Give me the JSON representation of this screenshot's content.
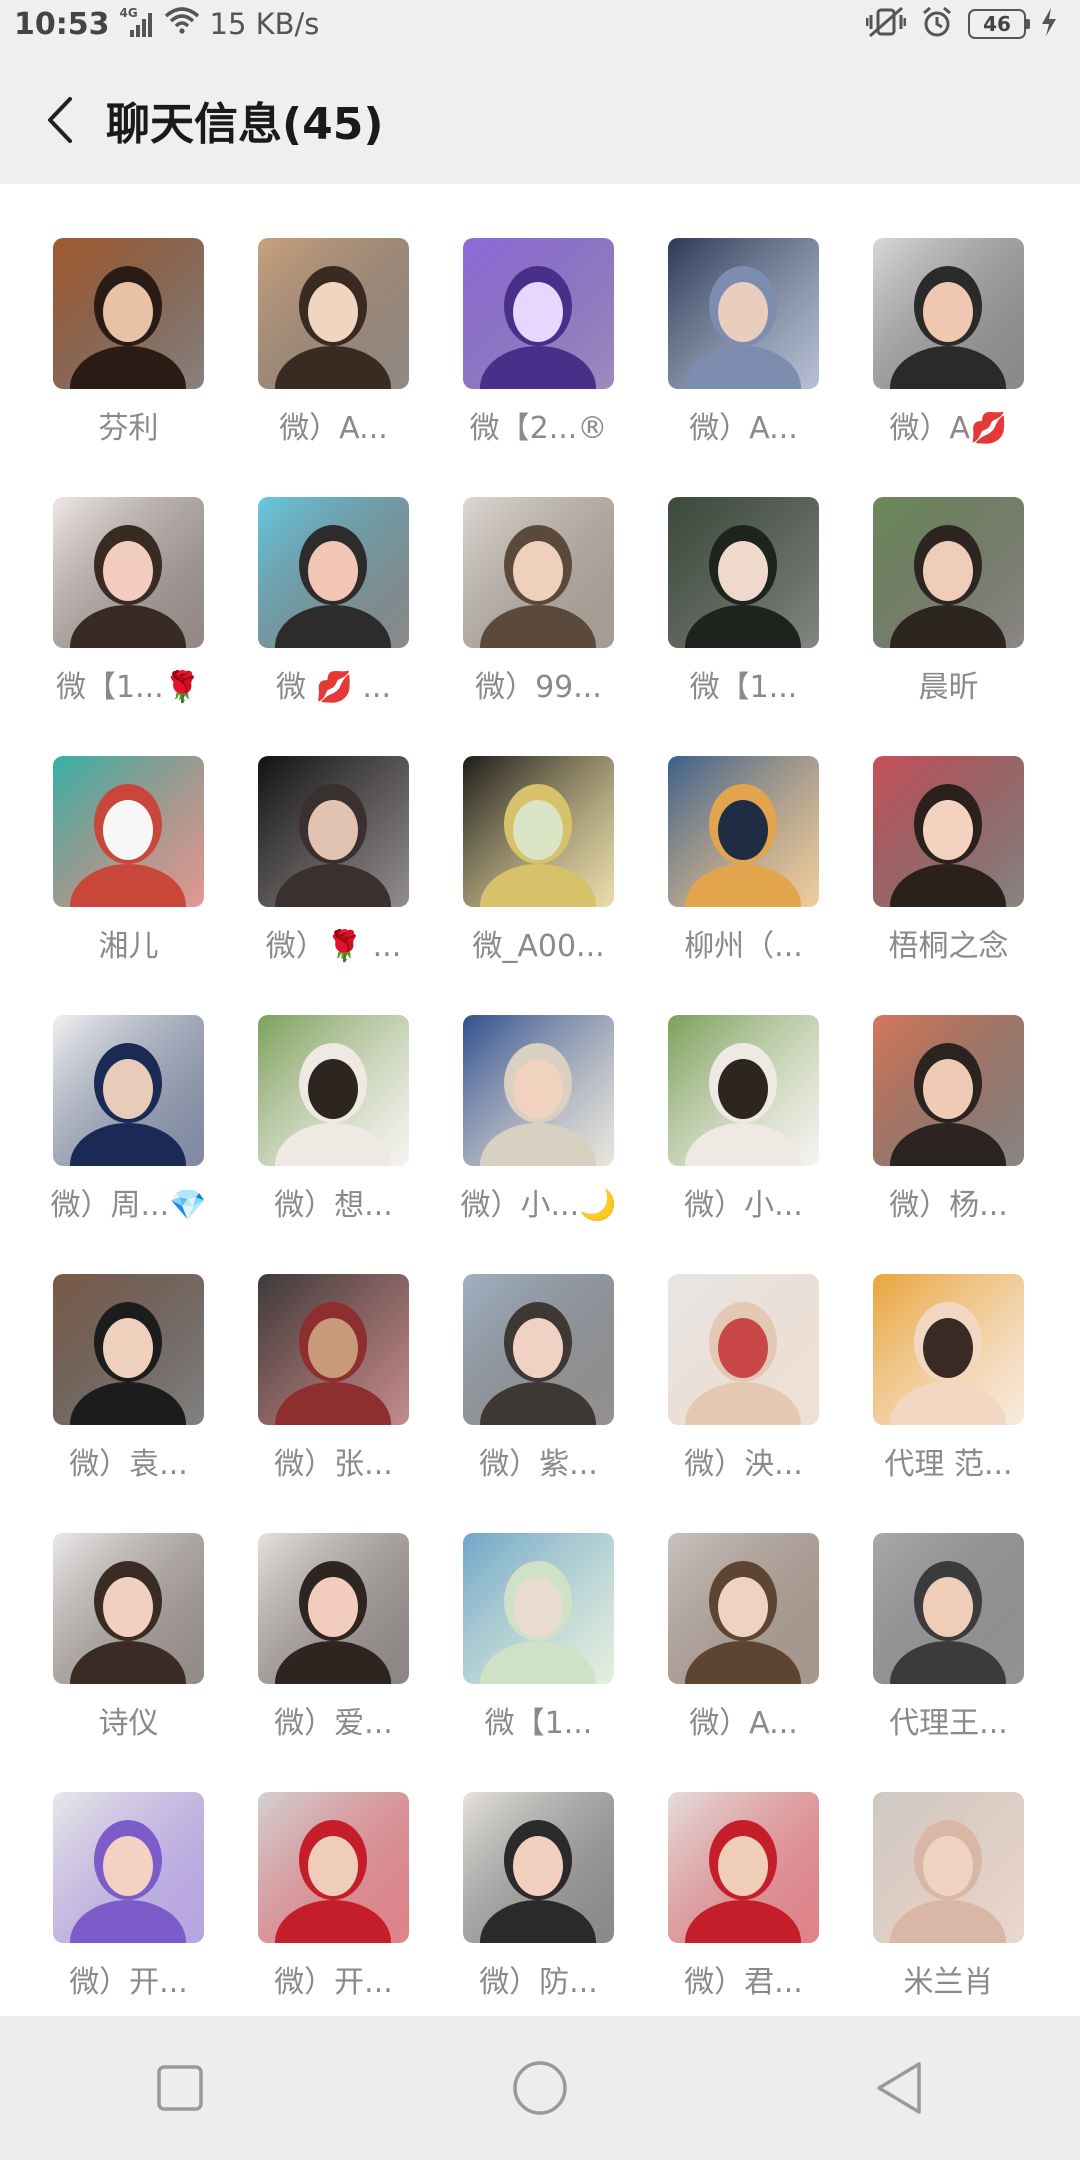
{
  "status_bar": {
    "time": "10:53",
    "network_label": "4G",
    "speed": "15 KB/s",
    "battery_level": "46"
  },
  "header": {
    "title": "聊天信息(45)"
  },
  "members": [
    {
      "name": "芬利",
      "colors": [
        "#a35a2e",
        "#2a1c15",
        "#e8c2a6"
      ]
    },
    {
      "name": "微）A...",
      "colors": [
        "#c9a27f",
        "#3a2b22",
        "#f0d6c0"
      ]
    },
    {
      "name": "微【2...®",
      "colors": [
        "#8e6bd8",
        "#4a2f8a",
        "#e7d7ff"
      ]
    },
    {
      "name": "微）A...",
      "colors": [
        "#2e3a54",
        "#7d8db0",
        "#e9cdbd"
      ]
    },
    {
      "name": "微）A💋",
      "colors": [
        "#d9d9d9",
        "#2a2a2a",
        "#f0c7b0"
      ]
    },
    {
      "name": "微【1...🌹",
      "colors": [
        "#efe8e6",
        "#3a2a24",
        "#f2cdbd"
      ]
    },
    {
      "name": "微 💋 ...",
      "colors": [
        "#68c8df",
        "#2d2b2b",
        "#f1c6b6"
      ]
    },
    {
      "name": "微）99...",
      "colors": [
        "#dcd8d2",
        "#5b4a3c",
        "#efd0bd"
      ]
    },
    {
      "name": "微【1...",
      "colors": [
        "#3b4a3a",
        "#1e241d",
        "#efd9cd"
      ]
    },
    {
      "name": "晨昕",
      "colors": [
        "#6a8a5a",
        "#2d2520",
        "#f0cdb8"
      ]
    },
    {
      "name": "湘儿",
      "colors": [
        "#34b3a8",
        "#c8473a",
        "#f7f7f7"
      ]
    },
    {
      "name": "微）🌹 ...",
      "colors": [
        "#121212",
        "#3a3030",
        "#e2c2b0"
      ]
    },
    {
      "name": "微_A00...",
      "colors": [
        "#1b1b1b",
        "#d7c16a",
        "#d9e4c5"
      ]
    },
    {
      "name": "柳州（...",
      "colors": [
        "#3a5f8c",
        "#e3a44e",
        "#1e2c44"
      ]
    },
    {
      "name": "梧桐之念",
      "colors": [
        "#c8505a",
        "#2a201c",
        "#f3d3c0"
      ]
    },
    {
      "name": "微）周...💎",
      "colors": [
        "#f2f2f2",
        "#1a2a55",
        "#e8cbb8"
      ]
    },
    {
      "name": "微）想...",
      "colors": [
        "#7ba05a",
        "#efe9e4",
        "#2d2520"
      ]
    },
    {
      "name": "微）小...🌙",
      "colors": [
        "#2f4f8f",
        "#d8d0c0",
        "#f0d2bf"
      ]
    },
    {
      "name": "微）小...",
      "colors": [
        "#7ba05a",
        "#efe9e4",
        "#2d2520"
      ]
    },
    {
      "name": "微）杨...",
      "colors": [
        "#d8785a",
        "#2a2320",
        "#efcbb6"
      ]
    },
    {
      "name": "微）袁...",
      "colors": [
        "#7a5a48",
        "#1c1c1c",
        "#efd0bd"
      ]
    },
    {
      "name": "微）张...",
      "colors": [
        "#3b3b3b",
        "#8e2f2f",
        "#c99a7a"
      ]
    },
    {
      "name": "微）紫...",
      "colors": [
        "#9fb1c4",
        "#3d3834",
        "#f0d2c4"
      ]
    },
    {
      "name": "微）泱...",
      "colors": [
        "#e6e6e6",
        "#e3c8b4",
        "#c94747"
      ]
    },
    {
      "name": "代理 范...",
      "colors": [
        "#e8a53a",
        "#f2d8c2",
        "#3a2c24"
      ]
    },
    {
      "name": "诗仪",
      "colors": [
        "#eceaea",
        "#3a2c25",
        "#f1d0c0"
      ]
    },
    {
      "name": "微）爱...",
      "colors": [
        "#e6e2de",
        "#2e2420",
        "#f2cdbd"
      ]
    },
    {
      "name": "微【1...",
      "colors": [
        "#6fa6c9",
        "#cfe1c7",
        "#e8dcd0"
      ]
    },
    {
      "name": "微）A...",
      "colors": [
        "#c8c2be",
        "#5e4433",
        "#f0d2c0"
      ]
    },
    {
      "name": "代理王...",
      "colors": [
        "#a9a9a9",
        "#3b3b3b",
        "#efcdb8"
      ]
    },
    {
      "name": "微）开...",
      "colors": [
        "#e9e9e9",
        "#7b5cc8",
        "#f3d1c3"
      ]
    },
    {
      "name": "微）开...",
      "colors": [
        "#d3d3d3",
        "#c41e2a",
        "#efcdb8"
      ]
    },
    {
      "name": "微）防...",
      "colors": [
        "#e6e3df",
        "#2a2a2a",
        "#f1d0c0"
      ]
    },
    {
      "name": "微）君...",
      "colors": [
        "#e4e0dc",
        "#c41e2a",
        "#f0cdb8"
      ]
    },
    {
      "name": "米兰肖",
      "colors": [
        "#cfc9c3",
        "#d9b6a6",
        "#efd2c0"
      ]
    }
  ]
}
